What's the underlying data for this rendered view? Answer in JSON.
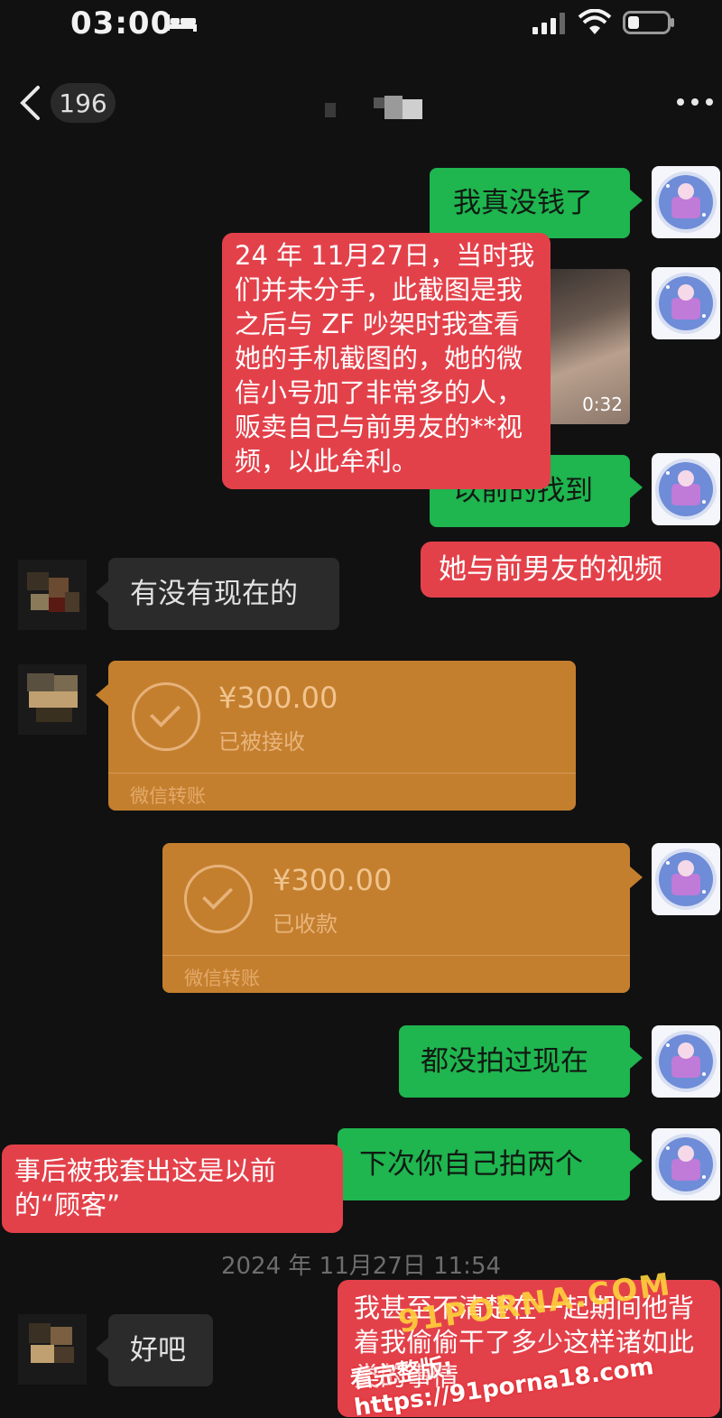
{
  "status_bar": {
    "time": "03:00",
    "icons": [
      "bed-icon",
      "signal-icon",
      "wifi-icon",
      "battery-icon"
    ]
  },
  "header": {
    "back_icon": "chevron-left-icon",
    "unread_count": "196",
    "more_icon": "more-icon"
  },
  "messages": [
    {
      "side": "right",
      "type": "text",
      "text": "我真没钱了"
    },
    {
      "side": "right",
      "type": "video",
      "duration": "0:32"
    },
    {
      "side": "right",
      "type": "text",
      "text": "以前的找到"
    },
    {
      "side": "left",
      "type": "text",
      "text": "有没有现在的"
    },
    {
      "side": "left",
      "type": "transfer",
      "amount": "¥300.00",
      "status": "已被接收",
      "label": "微信转账"
    },
    {
      "side": "right",
      "type": "transfer",
      "amount": "¥300.00",
      "status": "已收款",
      "label": "微信转账"
    },
    {
      "side": "right",
      "type": "text",
      "text": "都没拍过现在"
    },
    {
      "side": "right",
      "type": "text",
      "text": "下次你自己拍两个"
    },
    {
      "side": "left",
      "type": "text",
      "text": "好吧"
    }
  ],
  "timestamp": "2024 年 11月27日 11:54",
  "notes": [
    "24 年 11月27日，当时我们并未分手，此截图是我之后与 ZF 吵架时我查看她的手机截图的，她的微信小号加了非常多的人，贩卖自己与前男友的**视频，以此牟利。",
    "她与前男友的视频",
    "事后被我套出这是以前的“顾客”",
    "我甚至不清楚在一起期间他背着我偷偷干了多少这样诸如此类的事情"
  ],
  "watermarks": [
    "91PORNA.COM",
    "看完整版: https://91porna18.com"
  ],
  "colors": {
    "background": "#111111",
    "bubble_green": "#1fb54f",
    "bubble_gray": "#2b2b2b",
    "transfer": "#c47f2e",
    "note_red": "#e3414a"
  }
}
